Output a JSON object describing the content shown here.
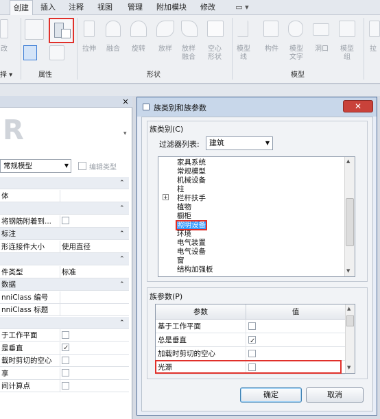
{
  "ribbon": {
    "tabs": [
      "创建",
      "插入",
      "注释",
      "视图",
      "管理",
      "附加模块",
      "修改",
      "▭ ▾"
    ],
    "forms_buttons": [
      "拉伸",
      "融合",
      "旋转",
      "放样",
      "放样融合",
      "空心形状"
    ],
    "model_buttons": [
      "模型线",
      "构件",
      "模型文字",
      "洞口",
      "模型组"
    ],
    "left_cut": [
      "改",
      "择 ▾"
    ],
    "right_cut": "拉",
    "groups": {
      "properties": "属性",
      "forms": "形状",
      "model": "模型"
    }
  },
  "properties_palette": {
    "close": "×",
    "type_selector": "常规模型",
    "edit_type": "编辑类型",
    "rows": [
      {
        "l": "",
        "v": "",
        "hdr": true,
        "arrow": "⌃"
      },
      {
        "l": "体",
        "v": ""
      },
      {
        "l": "",
        "v": "",
        "hdr": true,
        "arrow": "⌃"
      },
      {
        "l": "将钢筋附着到...",
        "v": "",
        "check": "off"
      },
      {
        "l": "标注",
        "v": "",
        "hdr": true,
        "arrow": "⌃"
      },
      {
        "l": "形连接件大小",
        "v": "使用直径"
      },
      {
        "l": "",
        "v": "",
        "hdr": true,
        "arrow": "⌃"
      },
      {
        "l": "件类型",
        "v": "标准"
      },
      {
        "l": "数据",
        "v": "",
        "hdr": true,
        "arrow": "⌃"
      },
      {
        "l": "nniClass 编号",
        "v": ""
      },
      {
        "l": "nniClass 标题",
        "v": ""
      },
      {
        "l": "",
        "v": "",
        "hdr": true,
        "arrow": "⌃"
      },
      {
        "l": "于工作平面",
        "v": "",
        "check": "off"
      },
      {
        "l": "是垂直",
        "v": "",
        "check": "on"
      },
      {
        "l": "载时剪切的空心",
        "v": "",
        "check": "off"
      },
      {
        "l": "享",
        "v": "",
        "check": "off"
      },
      {
        "l": "间计算点",
        "v": "",
        "check": "off"
      }
    ]
  },
  "dialog": {
    "title": "族类别和族参数",
    "close": "✕",
    "category_label": "族类别(C)",
    "filter_label": "过滤器列表:",
    "filter_value": "建筑",
    "categories": [
      "家具系统",
      "常规模型",
      "机械设备",
      "柱",
      "栏杆扶手",
      "植物",
      "橱柜",
      "照明设备",
      "环境",
      "电气装置",
      "电气设备",
      "窗",
      "结构加强板"
    ],
    "selected_category": "照明设备",
    "params_label": "族参数(P)",
    "param_col": "参数",
    "value_col": "值",
    "params": [
      {
        "name": "基于工作平面",
        "check": "off"
      },
      {
        "name": "总是垂直",
        "check": "on"
      },
      {
        "name": "加载时剪切的空心",
        "check": "off"
      },
      {
        "name": "光源",
        "check": "off"
      }
    ],
    "ok": "确定",
    "cancel": "取消"
  },
  "colors": {
    "highlight_red": "#e0302a",
    "selection_blue": "#3399ff",
    "titlebar": "#c8d7ea"
  }
}
